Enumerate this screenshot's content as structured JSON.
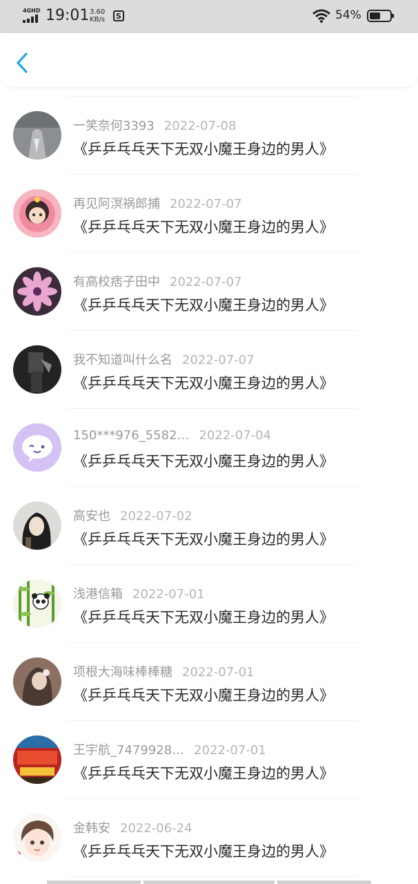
{
  "status_bar": {
    "network": "4GHD",
    "time": "19:01",
    "speed_value": "3.60",
    "speed_unit": "KB/s",
    "battery": "54%",
    "battery_level": 0.54
  },
  "header": {
    "back_icon": "chevron-left-icon",
    "accent_color": "#2aa3e8"
  },
  "items": [
    {
      "user": "一笑奈何3393",
      "date": "2022-07-08",
      "title": "《乒乒乓乓天下无双小魔王身边的男人》",
      "avatar": "gray-photo"
    },
    {
      "user": "再见阿溟祸郎捕",
      "date": "2022-07-07",
      "title": "《乒乒乓乓天下无双小魔王身边的男人》",
      "avatar": "pink-cartoon"
    },
    {
      "user": "有高校痞子田中",
      "date": "2022-07-07",
      "title": "《乒乒乓乓天下无双小魔王身边的男人》",
      "avatar": "flower"
    },
    {
      "user": "我不知道叫什么名",
      "date": "2022-07-07",
      "title": "《乒乒乓乓天下无双小魔王身边的男人》",
      "avatar": "dark-photo"
    },
    {
      "user": "150***976_5582…",
      "date": "2022-07-04",
      "title": "《乒乒乓乓天下无双小魔王身边的男人》",
      "avatar": "purple-chat"
    },
    {
      "user": "高安也",
      "date": "2022-07-02",
      "title": "《乒乒乓乓天下无双小魔王身边的男人》",
      "avatar": "girl-photo"
    },
    {
      "user": "浅港信箱",
      "date": "2022-07-01",
      "title": "《乒乒乓乓天下无双小魔王身边的男人》",
      "avatar": "bamboo-panda"
    },
    {
      "user": "项根大海味棒棒糖",
      "date": "2022-07-01",
      "title": "《乒乒乓乓天下无双小魔王身边的男人》",
      "avatar": "brown-girl"
    },
    {
      "user": "王宇航_7479928…",
      "date": "2022-07-01",
      "title": "《乒乒乓乓天下无双小魔王身边的男人》",
      "avatar": "red-street"
    },
    {
      "user": "金韩安",
      "date": "2022-06-24",
      "title": "《乒乒乓乓天下无双小魔王身边的男人》",
      "avatar": "anime-boy"
    }
  ]
}
